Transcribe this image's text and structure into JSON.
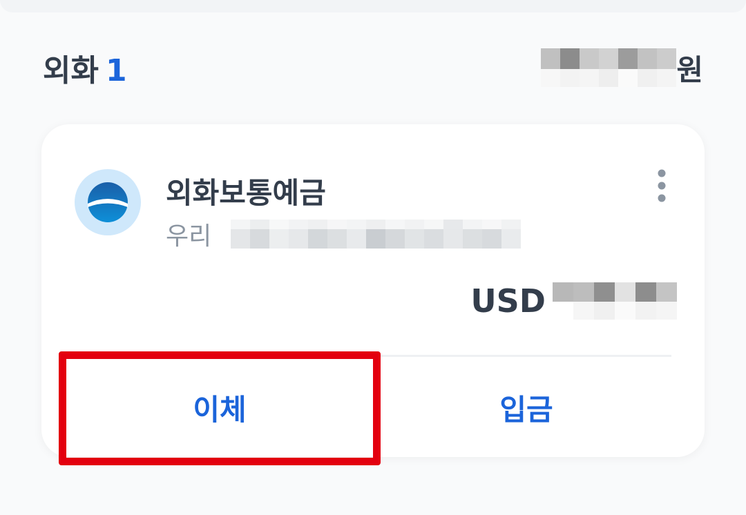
{
  "section": {
    "title": "외화",
    "count": "1",
    "total_unit": "원"
  },
  "account": {
    "name": "외화보통예금",
    "bank": "우리",
    "currency": "USD"
  },
  "actions": {
    "transfer_label": "이체",
    "deposit_label": "입금"
  },
  "icons": {
    "bank_logo": "woori-bank-logo-icon",
    "more": "more-vertical-icon"
  },
  "colors": {
    "accent": "#1b64da",
    "text_primary": "#333d4b",
    "text_secondary": "#8b95a1",
    "highlight": "#e3000f"
  }
}
